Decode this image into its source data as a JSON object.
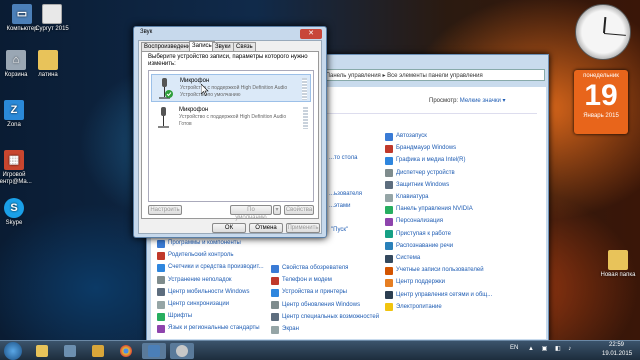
{
  "desktop": {
    "icons": [
      {
        "label": "Компьютер",
        "color": "#4b7fb8",
        "glyph": "▭",
        "icon": "computer-icon"
      },
      {
        "label": "Сургут 2015",
        "color": "#e8e8e8",
        "glyph": "",
        "icon": "document-icon"
      },
      {
        "label": "Корзина",
        "color": "#9aa7b4",
        "glyph": "🗑",
        "icon": "recycle-bin-icon"
      },
      {
        "label": "латина",
        "color": "#e8c35a",
        "glyph": "",
        "icon": "folder-icon"
      },
      {
        "label": "Zona",
        "color": "#2a89d8",
        "glyph": "Z",
        "icon": "zona-icon"
      },
      {
        "label": "Игровой центр@Ma...",
        "color": "#c8462f",
        "glyph": "▦",
        "icon": "game-center-icon"
      },
      {
        "label": "Skype",
        "color": "#1aa0e8",
        "glyph": "S",
        "icon": "skype-icon"
      },
      {
        "label": "Новая папка",
        "color": "#e8c35a",
        "glyph": "",
        "icon": "new-folder-icon"
      }
    ]
  },
  "gadgets": {
    "calendar": {
      "dow": "понедельник",
      "day": "19",
      "month": "Январь 2015"
    }
  },
  "control_panel": {
    "address": "▸ Панель управления ▸ Все элементы панели управления",
    "search_placeholder": "Поиск в панели управления",
    "view_label": "Просмотр:",
    "view_value": "Мелкие значки ▾",
    "left_items": [
      "Автозапуск",
      "Брандмауэр Windows",
      "Графика и медиа Intel(R)",
      "Диспетчер устройств",
      "Защитник Windows",
      "Клавиатура",
      "Панель управления NVIDIA",
      "Персонализация",
      "Приступая к работе",
      "Распознавание речи",
      "Система",
      "Учетные записи пользователей",
      "Центр поддержки",
      "Центр управления сетями и общ...",
      "Электропитание"
    ],
    "col1_items": [
      "Программы и компоненты",
      "Родительский контроль",
      "Счетчики и средства производит...",
      "Устранение неполадок",
      "Центр мобильности Windows",
      "Центр синхронизации",
      "Шрифты",
      "Язык и региональные стандарты"
    ],
    "col2_partial": [
      "...то стола",
      "...ьзователя",
      "...этами",
      "\"Пуск\""
    ],
    "col2_items": [
      "Свойства обозревателя",
      "Телефон и модем",
      "Устройства и принтеры",
      "Центр обновления Windows",
      "Центр специальных возможностей",
      "Экран"
    ]
  },
  "sound_dialog": {
    "title": "Звук",
    "close": "✕",
    "tabs": [
      "Воспроизведение",
      "Запись",
      "Звуки",
      "Связь"
    ],
    "instruction": "Выберите устройство записи, параметры которого нужно изменить:",
    "devices": [
      {
        "name": "Микрофон",
        "desc": "Устройство с поддержкой High Definition Audio",
        "status": "Устройство по умолчанию"
      },
      {
        "name": "Микрофон",
        "desc": "Устройство с поддержкой High Definition Audio",
        "status": "Готов"
      }
    ],
    "buttons": {
      "configure": "Настроить",
      "default": "По умолчанию",
      "properties": "Свойства",
      "ok": "ОК",
      "cancel": "Отмена",
      "apply": "Применить"
    }
  },
  "taskbar": {
    "lang": "EN",
    "time": "22:59",
    "date": "19.01.2015"
  }
}
